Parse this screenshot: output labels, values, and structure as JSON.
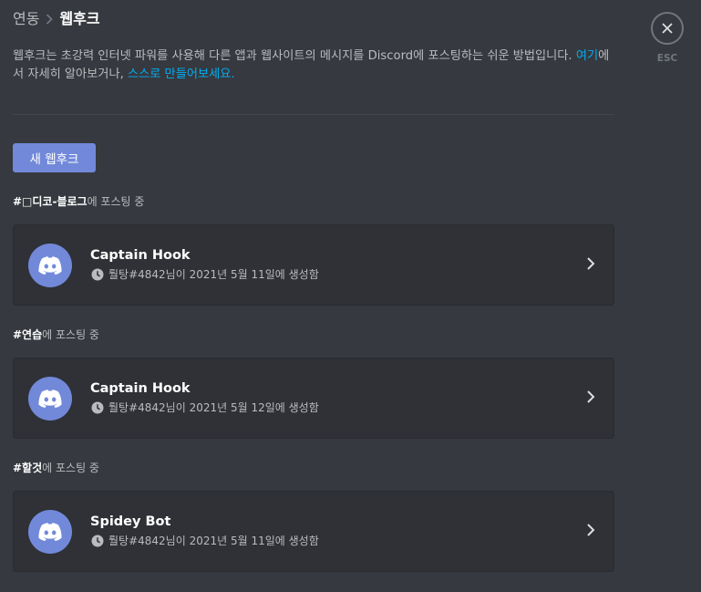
{
  "breadcrumb": {
    "parent": "연동",
    "current": "웹후크"
  },
  "description": {
    "part1": "웹후크는 초강력 인터넷 파워를 사용해 다른 앱과 웹사이트의 메시지를 Discord에 포스팅하는 쉬운 방법입니다. ",
    "link1": "여기",
    "part2": "에서 자세히 알아보거나, ",
    "link2": "스스로 만들어보세요.",
    "part3": ""
  },
  "new_webhook_button": "새 웹후크",
  "posting_suffix": "에 포스팅 중",
  "groups": [
    {
      "channel": "#□디코-블로그",
      "webhook": {
        "name": "Captain Hook",
        "meta": "뤌탕#4842님이 2021년 5월 11일에 생성함"
      }
    },
    {
      "channel": "#연습",
      "webhook": {
        "name": "Captain Hook",
        "meta": "뤌탕#4842님이 2021년 5월 12일에 생성함"
      }
    },
    {
      "channel": "#할것",
      "webhook": {
        "name": "Spidey Bot",
        "meta": "뤌탕#4842님이 2021년 5월 11일에 생성함"
      }
    }
  ],
  "close": {
    "esc_label": "ESC"
  },
  "colors": {
    "background": "#36393f",
    "card": "#2f3136",
    "accent": "#7289da",
    "link": "#00aff4"
  }
}
